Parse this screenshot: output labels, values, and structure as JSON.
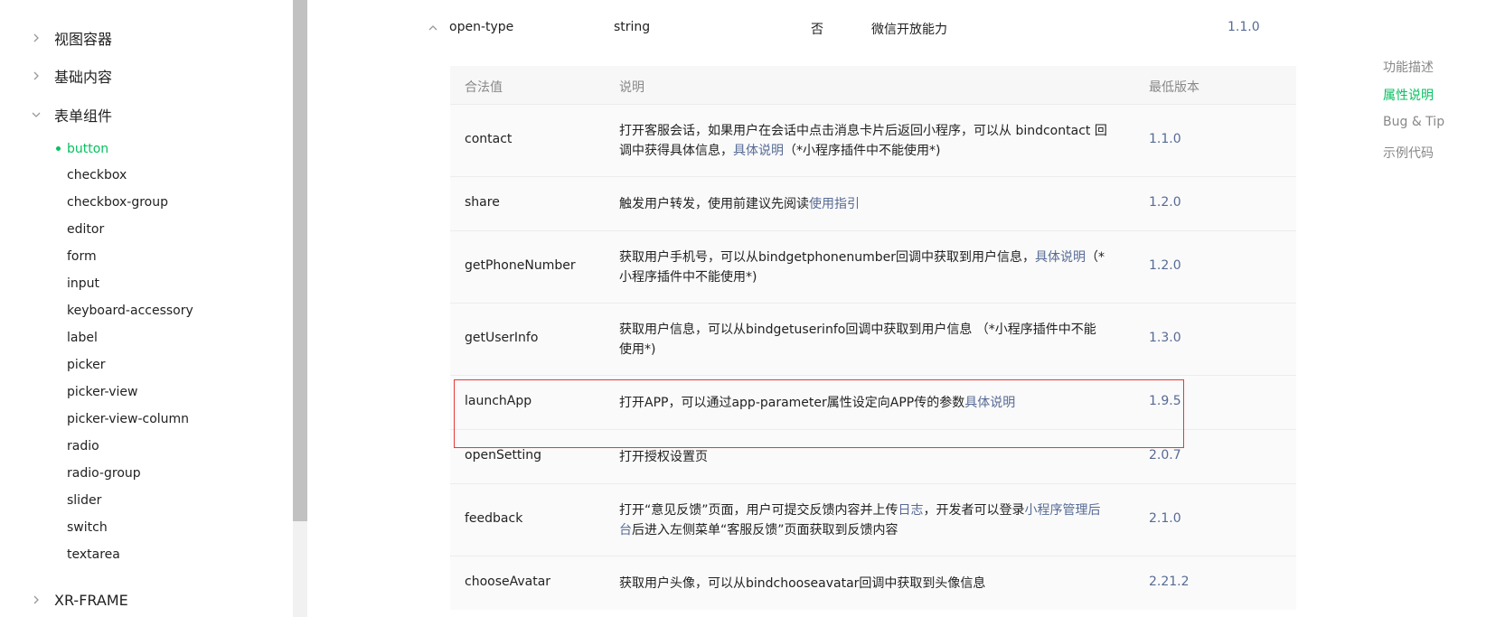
{
  "sidebar": {
    "categories": [
      {
        "label": "视图容器",
        "expanded": false
      },
      {
        "label": "基础内容",
        "expanded": false
      },
      {
        "label": "表单组件",
        "expanded": true
      },
      {
        "label": "XR-FRAME",
        "expanded": false
      }
    ],
    "items": [
      "button",
      "checkbox",
      "checkbox-group",
      "editor",
      "form",
      "input",
      "keyboard-accessory",
      "label",
      "picker",
      "picker-view",
      "picker-view-column",
      "radio",
      "radio-group",
      "slider",
      "switch",
      "textarea"
    ],
    "active_item": "button"
  },
  "prop": {
    "name": "open-type",
    "type": "string",
    "required": "否",
    "desc": "微信开放能力",
    "version": "1.1.0"
  },
  "values_table": {
    "headers": [
      "合法值",
      "说明",
      "最低版本"
    ],
    "rows": [
      {
        "value": "contact",
        "desc_before": "打开客服会话，如果用户在会话中点击消息卡片后返回小程序，可以从 bindcontact 回调中获得具体信息，",
        "link1": "具体说明",
        "desc_mid": "（*小程序插件中不能使用*)",
        "link2": "",
        "desc_after": "",
        "version": "1.1.0"
      },
      {
        "value": "share",
        "desc_before": "触发用户转发，使用前建议先阅读",
        "link1": "使用指引",
        "desc_mid": "",
        "link2": "",
        "desc_after": "",
        "version": "1.2.0"
      },
      {
        "value": "getPhoneNumber",
        "desc_before": "获取用户手机号，可以从bindgetphonenumber回调中获取到用户信息，",
        "link1": "具体说明",
        "desc_mid": "（*小程序插件中不能使用*)",
        "link2": "",
        "desc_after": "",
        "version": "1.2.0"
      },
      {
        "value": "getUserInfo",
        "desc_before": "获取用户信息，可以从bindgetuserinfo回调中获取到用户信息 （*小程序插件中不能使用*)",
        "link1": "",
        "desc_mid": "",
        "link2": "",
        "desc_after": "",
        "version": "1.3.0"
      },
      {
        "value": "launchApp",
        "desc_before": "打开APP，可以通过app-parameter属性设定向APP传的参数",
        "link1": "具体说明",
        "desc_mid": "",
        "link2": "",
        "desc_after": "",
        "version": "1.9.5"
      },
      {
        "value": "openSetting",
        "desc_before": "打开授权设置页",
        "link1": "",
        "desc_mid": "",
        "link2": "",
        "desc_after": "",
        "version": "2.0.7"
      },
      {
        "value": "feedback",
        "desc_before": "打开“意见反馈”页面，用户可提交反馈内容并上传",
        "link1": "日志",
        "desc_mid": "，开发者可以登录",
        "link2": "小程序管理后台",
        "desc_after": "后进入左侧菜单“客服反馈”页面获取到反馈内容",
        "version": "2.1.0"
      },
      {
        "value": "chooseAvatar",
        "desc_before": "获取用户头像，可以从bindchooseavatar回调中获取到头像信息",
        "link1": "",
        "desc_mid": "",
        "link2": "",
        "desc_after": "",
        "version": "2.21.2"
      }
    ]
  },
  "toc": {
    "items": [
      "功能描述",
      "属性说明",
      "Bug & Tip",
      "示例代码"
    ],
    "active": "属性说明"
  },
  "colors": {
    "accent": "#07c160",
    "link": "#576b95",
    "highlight_border": "#e53935"
  }
}
